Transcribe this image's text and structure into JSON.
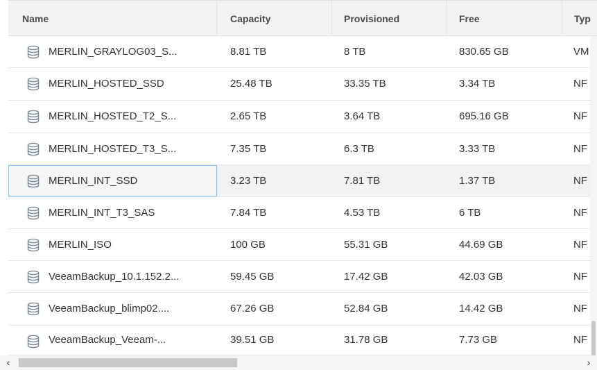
{
  "columns": [
    "Name",
    "Capacity",
    "Provisioned",
    "Free",
    "Typ"
  ],
  "rows": [
    {
      "name": "MERLIN_GRAYLOG03_S...",
      "capacity": "8.81 TB",
      "provisioned": "8 TB",
      "free": "830.65 GB",
      "type": "VM"
    },
    {
      "name": "MERLIN_HOSTED_SSD",
      "capacity": "25.48 TB",
      "provisioned": "33.35 TB",
      "free": "3.34 TB",
      "type": "NF"
    },
    {
      "name": "MERLIN_HOSTED_T2_S...",
      "capacity": "2.65 TB",
      "provisioned": "3.64 TB",
      "free": "695.16 GB",
      "type": "NF"
    },
    {
      "name": "MERLIN_HOSTED_T3_S...",
      "capacity": "7.35 TB",
      "provisioned": "6.3 TB",
      "free": "3.33 TB",
      "type": "NF"
    },
    {
      "name": "MERLIN_INT_SSD",
      "capacity": "3.23 TB",
      "provisioned": "7.81 TB",
      "free": "1.37 TB",
      "type": "NF",
      "selected": true
    },
    {
      "name": "MERLIN_INT_T3_SAS",
      "capacity": "7.84 TB",
      "provisioned": "4.53 TB",
      "free": "6 TB",
      "type": "NF"
    },
    {
      "name": "MERLIN_ISO",
      "capacity": "100 GB",
      "provisioned": "55.31 GB",
      "free": "44.69 GB",
      "type": "NF"
    },
    {
      "name": "VeeamBackup_10.1.152.2...",
      "capacity": "59.45 GB",
      "provisioned": "17.42 GB",
      "free": "42.03 GB",
      "type": "NF"
    },
    {
      "name": "VeeamBackup_blimp02....",
      "capacity": "67.26 GB",
      "provisioned": "52.84 GB",
      "free": "14.42 GB",
      "type": "NF"
    },
    {
      "name": "VeeamBackup_Veeam-...",
      "capacity": "39.51 GB",
      "provisioned": "31.78 GB",
      "free": "7.73 GB",
      "type": "NF"
    }
  ],
  "scroll": {
    "left_arrow": "‹",
    "right_arrow": "›"
  },
  "icons": {
    "row_icon": "database-icon"
  },
  "colors": {
    "selected_outline": "#7ec0ea",
    "icon_stroke": "#7a8a99"
  }
}
